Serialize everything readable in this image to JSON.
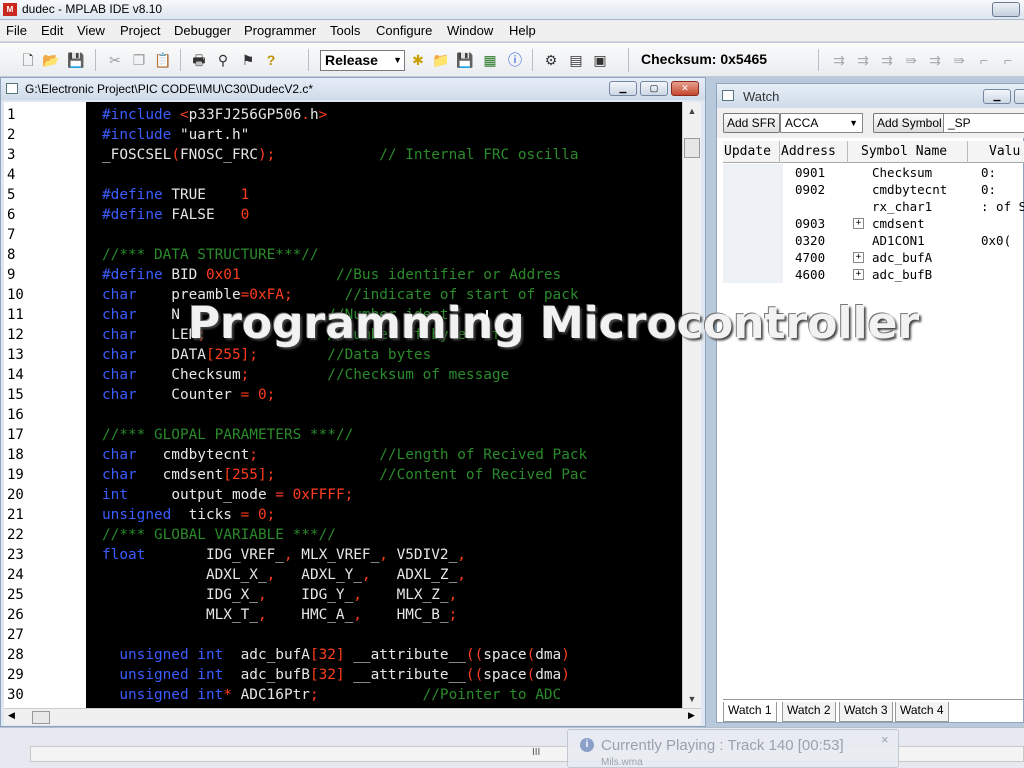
{
  "window": {
    "title": "dudec - MPLAB IDE v8.10",
    "app_icon": "mplab-icon"
  },
  "menu": [
    "File",
    "Edit",
    "View",
    "Project",
    "Debugger",
    "Programmer",
    "Tools",
    "Configure",
    "Window",
    "Help"
  ],
  "toolbar": {
    "build_config": "Release",
    "checksum": "Checksum:  0x5465",
    "icons": [
      "new-file-icon",
      "open-folder-icon",
      "save-icon",
      "cut-icon",
      "copy-icon",
      "paste-icon",
      "print-icon",
      "find-icon",
      "find-in-files-icon",
      "help-icon",
      "new-project-icon",
      "open-project-icon",
      "save-project-icon",
      "build-icon",
      "build-info-icon",
      "make-icon",
      "build-all-icon",
      "memory-icon"
    ]
  },
  "editor": {
    "title": "G:\\Electronic Project\\PIC CODE\\IMU\\C30\\DudecV2.c*",
    "line_numbers": [
      "1",
      "2",
      "3",
      "4",
      "5",
      "6",
      "7",
      "8",
      "9",
      "10",
      "11",
      "12",
      "13",
      "14",
      "15",
      "16",
      "17",
      "18",
      "19",
      "20",
      "21",
      "22",
      "23",
      "24",
      "25",
      "26",
      "27",
      "28",
      "29",
      "30"
    ],
    "lines": [
      [
        [
          "pp",
          "#include "
        ],
        [
          "pn",
          "<"
        ],
        [
          "id",
          "p33FJ256GP506"
        ],
        [
          "pn",
          "."
        ],
        [
          "id",
          "h"
        ],
        [
          "pn",
          ">"
        ]
      ],
      [
        [
          "pp",
          "#include "
        ],
        [
          "str",
          "\"uart.h\""
        ]
      ],
      [
        [
          "id",
          "_FOSCSEL"
        ],
        [
          "pn",
          "("
        ],
        [
          "id",
          "FNOSC_FRC"
        ],
        [
          "pn",
          ");"
        ],
        [
          "id",
          "            "
        ],
        [
          "cm",
          "// Internal FRC oscilla"
        ]
      ],
      [],
      [
        [
          "pp",
          "#define "
        ],
        [
          "id",
          "TRUE    "
        ],
        [
          "num",
          "1"
        ]
      ],
      [
        [
          "pp",
          "#define "
        ],
        [
          "id",
          "FALSE   "
        ],
        [
          "num",
          "0"
        ]
      ],
      [],
      [
        [
          "cm",
          "//*** DATA STRUCTURE***//"
        ]
      ],
      [
        [
          "pp",
          "#define "
        ],
        [
          "id",
          "BID "
        ],
        [
          "num",
          "0x01"
        ],
        [
          "id",
          "           "
        ],
        [
          "cm",
          "//Bus identifier or Addres"
        ]
      ],
      [
        [
          "kw",
          "char"
        ],
        [
          "id",
          "    preamble"
        ],
        [
          "pn",
          "="
        ],
        [
          "num",
          "0xFA"
        ],
        [
          "pn",
          ";"
        ],
        [
          "id",
          "      "
        ],
        [
          "cm",
          "//indicate of start of pack"
        ]
      ],
      [
        [
          "kw",
          "char"
        ],
        [
          "id",
          "    N"
        ],
        [
          "id",
          "                 "
        ],
        [
          "cm",
          "//Number ident  "
        ]
      ],
      [
        [
          "kw",
          "char"
        ],
        [
          "id",
          "    LEN"
        ],
        [
          "pn",
          ";"
        ],
        [
          "id",
          "              "
        ],
        [
          "cm",
          "//Number of bytes of"
        ]
      ],
      [
        [
          "kw",
          "char"
        ],
        [
          "id",
          "    DATA"
        ],
        [
          "pn",
          "["
        ],
        [
          "num",
          "255"
        ],
        [
          "pn",
          "];"
        ],
        [
          "id",
          "        "
        ],
        [
          "cm",
          "//Data bytes"
        ]
      ],
      [
        [
          "kw",
          "char"
        ],
        [
          "id",
          "    Checksum"
        ],
        [
          "pn",
          ";"
        ],
        [
          "id",
          "         "
        ],
        [
          "cm",
          "//Checksum of message"
        ]
      ],
      [
        [
          "kw",
          "char"
        ],
        [
          "id",
          "    Counter "
        ],
        [
          "pn",
          "="
        ],
        [
          "id",
          " "
        ],
        [
          "num",
          "0"
        ],
        [
          "pn",
          ";"
        ]
      ],
      [],
      [
        [
          "cm",
          "//*** GLOPAL PARAMETERS ***//"
        ]
      ],
      [
        [
          "kw",
          "char"
        ],
        [
          "id",
          "   cmdbytecnt"
        ],
        [
          "pn",
          ";"
        ],
        [
          "id",
          "              "
        ],
        [
          "cm",
          "//Length of Recived Pack"
        ]
      ],
      [
        [
          "kw",
          "char"
        ],
        [
          "id",
          "   cmdsent"
        ],
        [
          "pn",
          "["
        ],
        [
          "num",
          "255"
        ],
        [
          "pn",
          "];"
        ],
        [
          "id",
          "            "
        ],
        [
          "cm",
          "//Content of Recived Pac"
        ]
      ],
      [
        [
          "kw",
          "int"
        ],
        [
          "id",
          "     output_mode "
        ],
        [
          "pn",
          "="
        ],
        [
          "id",
          " "
        ],
        [
          "num",
          "0xFFFF"
        ],
        [
          "pn",
          ";"
        ]
      ],
      [
        [
          "kw",
          "unsigned"
        ],
        [
          "id",
          "  ticks "
        ],
        [
          "pn",
          "="
        ],
        [
          "id",
          " "
        ],
        [
          "num",
          "0"
        ],
        [
          "pn",
          ";"
        ]
      ],
      [
        [
          "cm",
          "//*** GLOBAL VARIABLE ***//"
        ]
      ],
      [
        [
          "kw",
          "float"
        ],
        [
          "id",
          "       IDG_VREF_"
        ],
        [
          "pn",
          ","
        ],
        [
          "id",
          " MLX_VREF_"
        ],
        [
          "pn",
          ","
        ],
        [
          "id",
          " V5DIV2_"
        ],
        [
          "pn",
          ","
        ]
      ],
      [
        [
          "id",
          "            ADXL_X_"
        ],
        [
          "pn",
          ","
        ],
        [
          "id",
          "   ADXL_Y_"
        ],
        [
          "pn",
          ","
        ],
        [
          "id",
          "   ADXL_Z_"
        ],
        [
          "pn",
          ","
        ]
      ],
      [
        [
          "id",
          "            IDG_X_"
        ],
        [
          "pn",
          ","
        ],
        [
          "id",
          "    IDG_Y_"
        ],
        [
          "pn",
          ","
        ],
        [
          "id",
          "    MLX_Z_"
        ],
        [
          "pn",
          ","
        ]
      ],
      [
        [
          "id",
          "            MLX_T_"
        ],
        [
          "pn",
          ","
        ],
        [
          "id",
          "    HMC_A_"
        ],
        [
          "pn",
          ","
        ],
        [
          "id",
          "    HMC_B_"
        ],
        [
          "pn",
          ";"
        ]
      ],
      [],
      [
        [
          "id",
          "  "
        ],
        [
          "kw",
          "unsigned int"
        ],
        [
          "id",
          "  adc_bufA"
        ],
        [
          "pn",
          "["
        ],
        [
          "num",
          "32"
        ],
        [
          "pn",
          "]"
        ],
        [
          "id",
          " __attribute__"
        ],
        [
          "pn",
          "(("
        ],
        [
          "id",
          "space"
        ],
        [
          "pn",
          "("
        ],
        [
          "id",
          "dma"
        ],
        [
          "pn",
          ")"
        ]
      ],
      [
        [
          "id",
          "  "
        ],
        [
          "kw",
          "unsigned int"
        ],
        [
          "id",
          "  adc_bufB"
        ],
        [
          "pn",
          "["
        ],
        [
          "num",
          "32"
        ],
        [
          "pn",
          "]"
        ],
        [
          "id",
          " __attribute__"
        ],
        [
          "pn",
          "(("
        ],
        [
          "id",
          "space"
        ],
        [
          "pn",
          "("
        ],
        [
          "id",
          "dma"
        ],
        [
          "pn",
          ")"
        ]
      ],
      [
        [
          "id",
          "  "
        ],
        [
          "kw",
          "unsigned int"
        ],
        [
          "pn",
          "*"
        ],
        [
          "id",
          " ADC16Ptr"
        ],
        [
          "pn",
          ";"
        ],
        [
          "id",
          "            "
        ],
        [
          "cm",
          "//Pointer to ADC"
        ]
      ]
    ]
  },
  "banner": "Programming Microcontroller",
  "watch": {
    "title": "Watch",
    "add_sfr": "Add SFR",
    "sfr_value": "ACCA",
    "add_symbol": "Add Symbol",
    "symbol_value": "_SP",
    "columns": [
      "Update",
      "Address",
      "Symbol Name",
      "Valu"
    ],
    "rows": [
      {
        "address": "0901",
        "symbol": "Checksum",
        "value": "0:",
        "expand": ""
      },
      {
        "address": "0902",
        "symbol": "cmdbytecnt",
        "value": "0:",
        "expand": ""
      },
      {
        "address": "",
        "symbol": "rx_char1",
        "value": ": of Sc",
        "expand": ""
      },
      {
        "address": "0903",
        "symbol": "cmdsent",
        "value": "",
        "expand": "+"
      },
      {
        "address": "0320",
        "symbol": "AD1CON1",
        "value": "0x0(",
        "expand": ""
      },
      {
        "address": "4700",
        "symbol": "adc_bufA",
        "value": "",
        "expand": "+"
      },
      {
        "address": "4600",
        "symbol": "adc_bufB",
        "value": "",
        "expand": "+"
      }
    ],
    "tabs": [
      "Watch 1",
      "Watch 2",
      "Watch 3",
      "Watch 4"
    ]
  },
  "notification": {
    "message": "Currently Playing : Track 140 [00:53]",
    "sub": "Mils.wma",
    "close": "×"
  },
  "statusbar": {
    "grip": "III"
  }
}
